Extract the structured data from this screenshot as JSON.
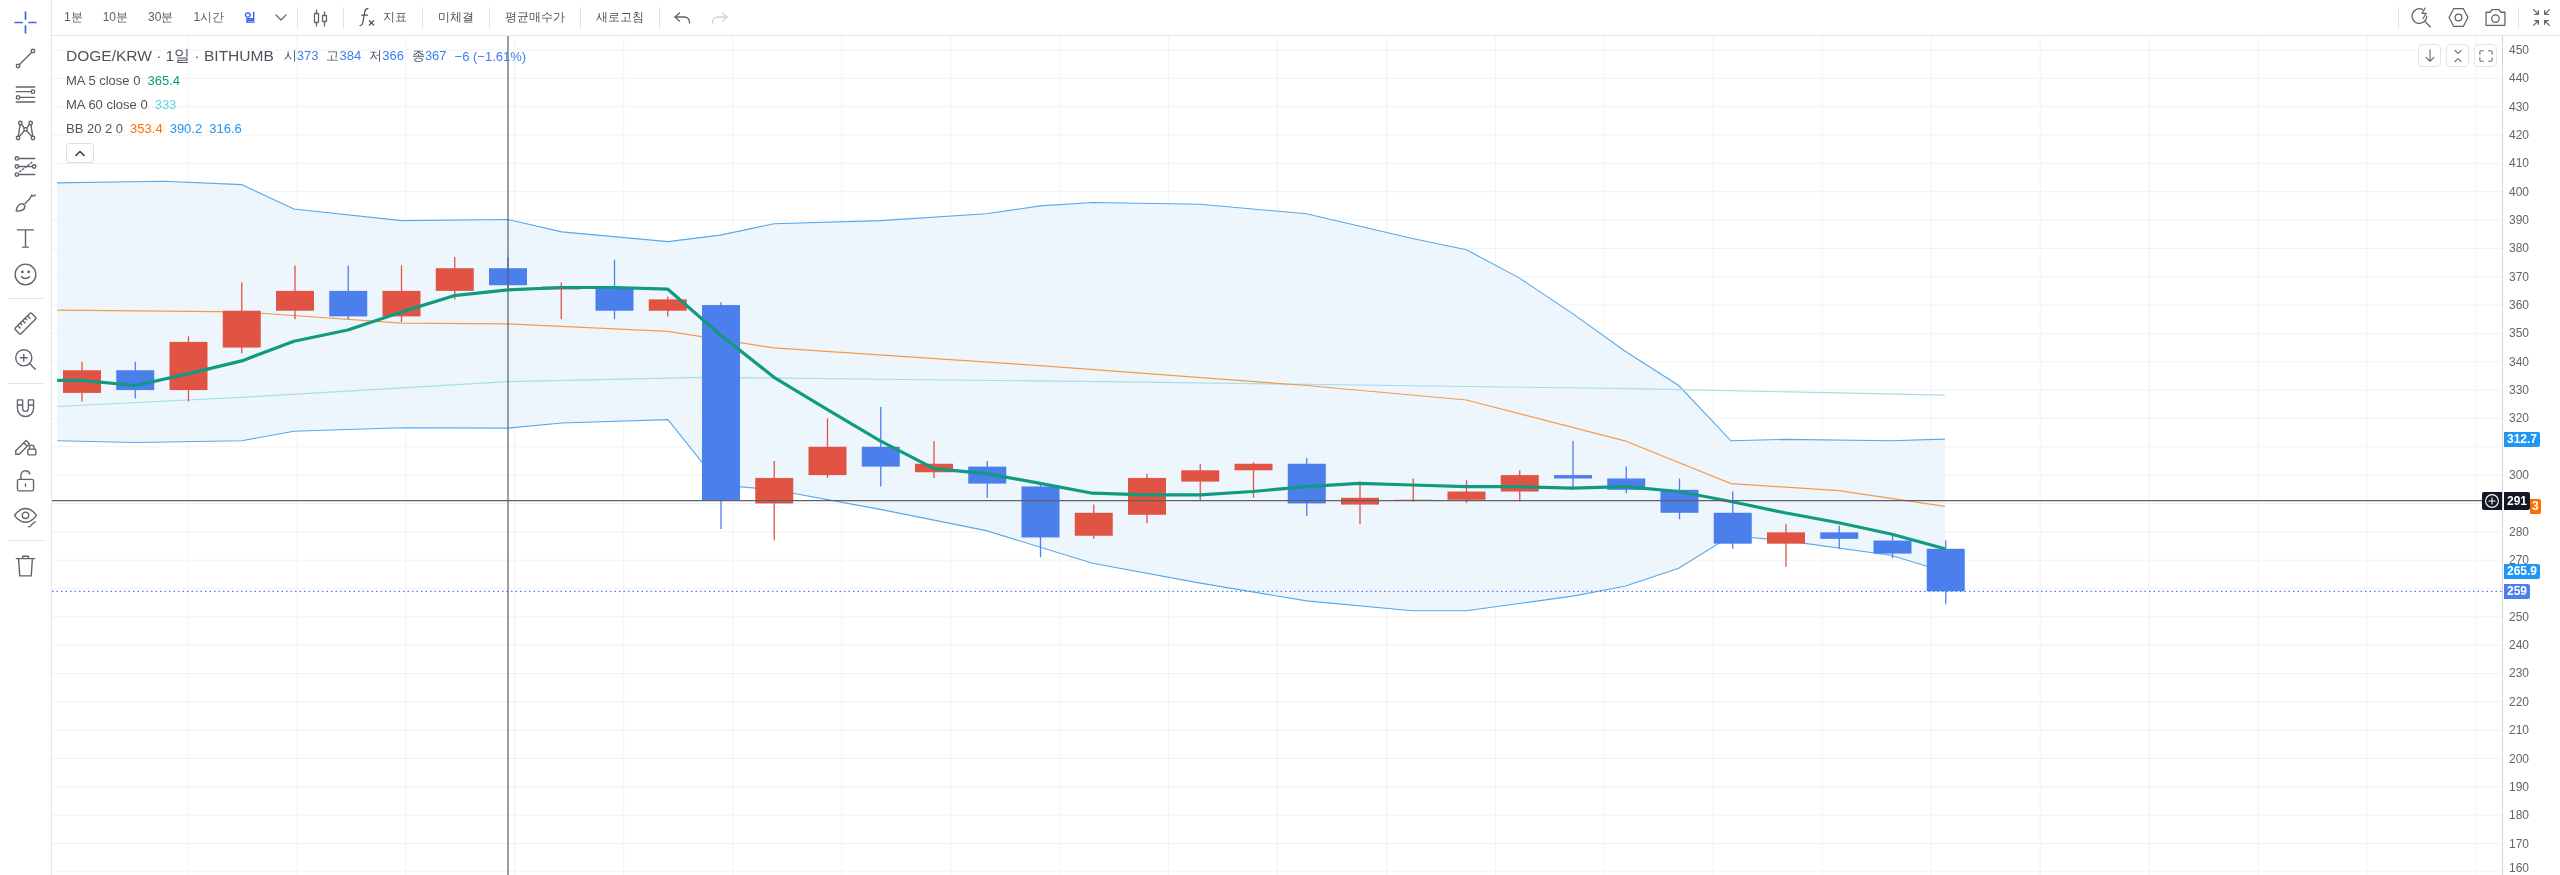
{
  "drawing_toolbar": {
    "groups": [
      {
        "tools": [
          {
            "kind": "crosshair",
            "selected": true
          },
          {
            "kind": "trend-line",
            "selected": false
          },
          {
            "kind": "parallel-lines",
            "selected": false
          },
          {
            "kind": "pattern",
            "selected": false
          },
          {
            "kind": "fib",
            "selected": false
          },
          {
            "kind": "brush",
            "selected": false
          },
          {
            "kind": "text",
            "selected": false
          },
          {
            "kind": "emoji",
            "selected": false
          }
        ]
      },
      {
        "tools": [
          {
            "kind": "ruler",
            "selected": false
          },
          {
            "kind": "zoom",
            "selected": false
          }
        ]
      },
      {
        "tools": [
          {
            "kind": "magnet",
            "selected": false
          },
          {
            "kind": "lock-drawings",
            "selected": false
          },
          {
            "kind": "unlock",
            "selected": false
          },
          {
            "kind": "hide",
            "selected": false
          }
        ]
      },
      {
        "tools": [
          {
            "kind": "trash",
            "selected": false
          }
        ]
      }
    ]
  },
  "top_toolbar": {
    "intervals": [
      {
        "label": "1분",
        "selected": false
      },
      {
        "label": "10분",
        "selected": false
      },
      {
        "label": "30분",
        "selected": false
      },
      {
        "label": "1시간",
        "selected": false
      },
      {
        "label": "일",
        "selected": true
      }
    ],
    "items": [
      {
        "kind": "chart-type"
      },
      {
        "kind": "indicators",
        "label": "지표"
      },
      {
        "kind": "button",
        "label": "미체결"
      },
      {
        "kind": "button",
        "label": "평균매수가"
      },
      {
        "kind": "button",
        "label": "새로고침"
      },
      {
        "kind": "undo",
        "disabled": false
      },
      {
        "kind": "redo",
        "disabled": true
      }
    ],
    "right_items": [
      {
        "kind": "quick-search"
      },
      {
        "kind": "settings"
      },
      {
        "kind": "screenshot"
      },
      {
        "kind": "collapse"
      }
    ]
  },
  "legend": {
    "title": "DOGE/KRW · 1일 · BITHUMB",
    "ohlc": [
      {
        "label": "시",
        "value": "373"
      },
      {
        "label": "고",
        "value": "384"
      },
      {
        "label": "저",
        "value": "366"
      },
      {
        "label": "종",
        "value": "367"
      }
    ],
    "change": "−6 (−1.61%)",
    "indicators": [
      {
        "name": "MA 5 close 0",
        "values": [
          {
            "text": "365.4",
            "color": "#089981"
          }
        ]
      },
      {
        "name": "MA 60 close 0",
        "values": [
          {
            "text": "333",
            "color": "#5fd2e0"
          }
        ]
      },
      {
        "name": "BB 20 2 0",
        "values": [
          {
            "text": "353.4",
            "color": "#ff6d00"
          },
          {
            "text": "390.2",
            "color": "#2196f3"
          },
          {
            "text": "316.6",
            "color": "#2196f3"
          }
        ]
      }
    ],
    "expanded": true
  },
  "chart": {
    "controls": [
      {
        "kind": "scroll-latest"
      },
      {
        "kind": "auto-fit"
      },
      {
        "kind": "reset"
      }
    ],
    "tags": [
      {
        "kind": "bb-upper",
        "text": "312.7",
        "color": "#2196f3"
      },
      {
        "kind": "crosshair",
        "text": "291",
        "color": "#131722"
      },
      {
        "kind": "bb-basis",
        "text": "3",
        "color": "#ff6d00"
      },
      {
        "kind": "bb-lower",
        "text": "265.9",
        "color": "#2196f3"
      },
      {
        "kind": "last-price",
        "text": "259",
        "color": "#4a7fec"
      }
    ],
    "price_labels": [
      "450",
      "440",
      "430",
      "420",
      "410",
      "400",
      "390",
      "380",
      "370",
      "360",
      "350",
      "340",
      "330",
      "320",
      "300",
      "280",
      "270",
      "250",
      "240",
      "230",
      "220",
      "210",
      "200",
      "190",
      "180",
      "170",
      "160"
    ]
  }
}
